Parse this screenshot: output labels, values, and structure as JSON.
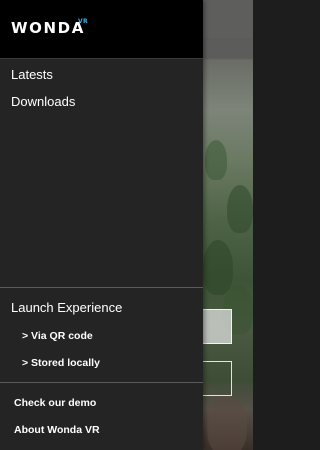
{
  "brand": {
    "name": "WONDA",
    "suffix": "VR"
  },
  "nav": {
    "items": [
      {
        "label": "Latests"
      },
      {
        "label": "Downloads"
      }
    ]
  },
  "launch": {
    "title": "Launch Experience",
    "options": [
      {
        "label": "> Via QR code"
      },
      {
        "label": "> Stored locally"
      }
    ]
  },
  "footer": {
    "items": [
      {
        "label": "Check our demo"
      },
      {
        "label": "About Wonda VR"
      }
    ]
  },
  "colors": {
    "drawer_bg": "#242424",
    "header_bg": "#000000",
    "accent": "#39b3e5",
    "text": "#ffffff"
  }
}
